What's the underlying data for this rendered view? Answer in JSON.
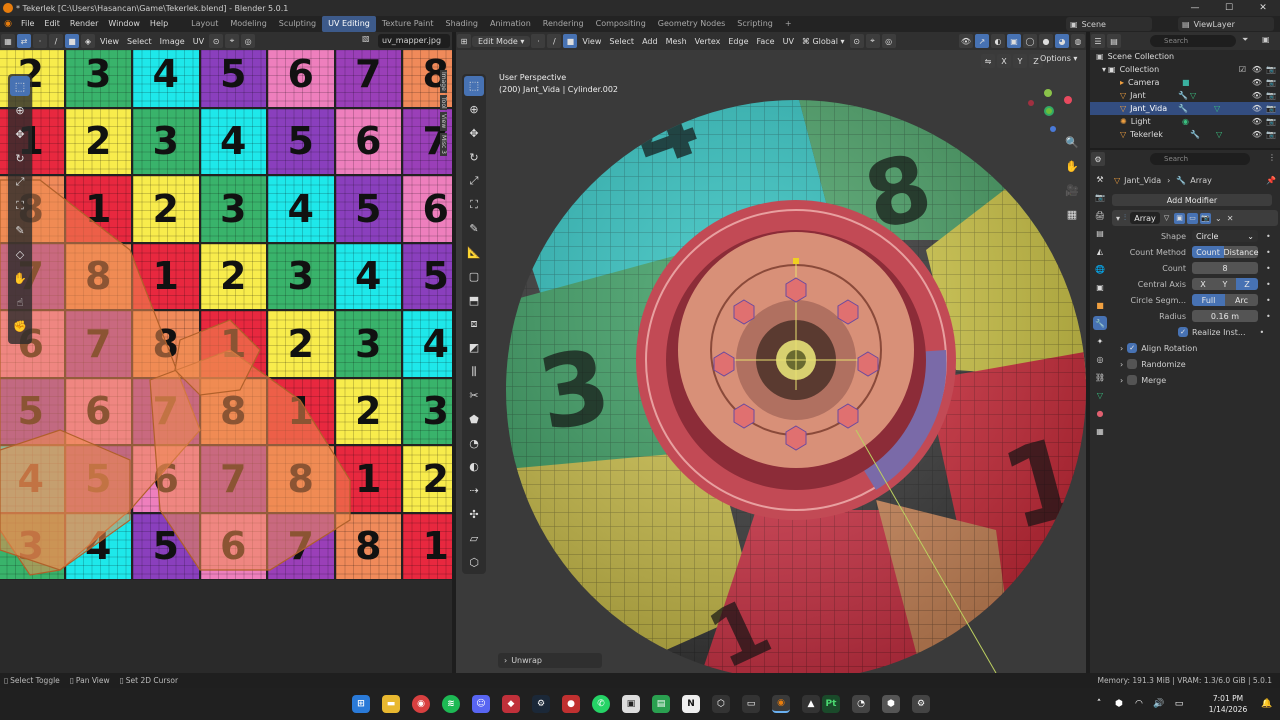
{
  "window": {
    "title": "* Tekerlek [C:\\Users\\Hasancan\\Game\\Tekerlek.blend] - Blender 5.0.1"
  },
  "menu": [
    "File",
    "Edit",
    "Render",
    "Window",
    "Help"
  ],
  "workspaces": [
    "Layout",
    "Modeling",
    "Sculpting",
    "UV Editing",
    "Texture Paint",
    "Shading",
    "Animation",
    "Rendering",
    "Compositing",
    "Geometry Nodes",
    "Scripting"
  ],
  "active_workspace": "UV Editing",
  "scene": {
    "label": "Scene",
    "view_layer": "ViewLayer"
  },
  "uv_editor": {
    "menus": [
      "View",
      "Select",
      "Image",
      "UV"
    ],
    "image_name": "uv_mapper.jpg",
    "side_tabs": [
      "Image",
      "Tool",
      "View",
      "Misc 3"
    ],
    "grid": [
      [
        {
          "n": "2",
          "c": "#f8ec4c"
        },
        {
          "n": "3",
          "c": "#39b36b"
        },
        {
          "n": "4",
          "c": "#1ee8ea"
        },
        {
          "n": "5",
          "c": "#8a3fbd"
        },
        {
          "n": "6",
          "c": "#ee7fbd"
        },
        {
          "n": "7",
          "c": "#9a3fb8"
        },
        {
          "n": "8",
          "c": "#f08a5a"
        }
      ],
      [
        {
          "n": "1",
          "c": "#e8283f"
        },
        {
          "n": "2",
          "c": "#f8ec4c"
        },
        {
          "n": "3",
          "c": "#39b36b"
        },
        {
          "n": "4",
          "c": "#1ee8ea"
        },
        {
          "n": "5",
          "c": "#8a3fbd"
        },
        {
          "n": "6",
          "c": "#ee7fbd"
        },
        {
          "n": "7",
          "c": "#9a3fb8"
        }
      ],
      [
        {
          "n": "8",
          "c": "#f08a5a"
        },
        {
          "n": "1",
          "c": "#e8283f"
        },
        {
          "n": "2",
          "c": "#f8ec4c"
        },
        {
          "n": "3",
          "c": "#39b36b"
        },
        {
          "n": "4",
          "c": "#1ee8ea"
        },
        {
          "n": "5",
          "c": "#8a3fbd"
        },
        {
          "n": "6",
          "c": "#ee7fbd"
        }
      ],
      [
        {
          "n": "7",
          "c": "#9a3fb8"
        },
        {
          "n": "8",
          "c": "#f08a5a"
        },
        {
          "n": "1",
          "c": "#e8283f"
        },
        {
          "n": "2",
          "c": "#f8ec4c"
        },
        {
          "n": "3",
          "c": "#39b36b"
        },
        {
          "n": "4",
          "c": "#1ee8ea"
        },
        {
          "n": "5",
          "c": "#8a3fbd"
        }
      ],
      [
        {
          "n": "6",
          "c": "#ee7fbd"
        },
        {
          "n": "7",
          "c": "#9a3fb8"
        },
        {
          "n": "8",
          "c": "#f08a5a"
        },
        {
          "n": "1",
          "c": "#e8283f"
        },
        {
          "n": "2",
          "c": "#f8ec4c"
        },
        {
          "n": "3",
          "c": "#39b36b"
        },
        {
          "n": "4",
          "c": "#1ee8ea"
        }
      ],
      [
        {
          "n": "5",
          "c": "#8a3fbd"
        },
        {
          "n": "6",
          "c": "#ee7fbd"
        },
        {
          "n": "7",
          "c": "#9a3fb8"
        },
        {
          "n": "8",
          "c": "#f08a5a"
        },
        {
          "n": "1",
          "c": "#e8283f"
        },
        {
          "n": "2",
          "c": "#f8ec4c"
        },
        {
          "n": "3",
          "c": "#39b36b"
        }
      ],
      [
        {
          "n": "4",
          "c": "#1ee8ea"
        },
        {
          "n": "5",
          "c": "#8a3fbd"
        },
        {
          "n": "6",
          "c": "#ee7fbd"
        },
        {
          "n": "7",
          "c": "#9a3fb8"
        },
        {
          "n": "8",
          "c": "#f08a5a"
        },
        {
          "n": "1",
          "c": "#e8283f"
        },
        {
          "n": "2",
          "c": "#f8ec4c"
        }
      ],
      [
        {
          "n": "3",
          "c": "#39b36b"
        },
        {
          "n": "4",
          "c": "#1ee8ea"
        },
        {
          "n": "5",
          "c": "#8a3fbd"
        },
        {
          "n": "6",
          "c": "#ee7fbd"
        },
        {
          "n": "7",
          "c": "#9a3fb8"
        },
        {
          "n": "8",
          "c": "#f08a5a"
        },
        {
          "n": "1",
          "c": "#e8283f"
        }
      ]
    ]
  },
  "viewport": {
    "mode": "Edit Mode",
    "menus": [
      "View",
      "Select",
      "Add",
      "Mesh",
      "Vertex",
      "Edge",
      "Face",
      "UV"
    ],
    "orientation": "Global",
    "perspective_label": "User Perspective",
    "object_label": "(200) Jant_Vida | Cylinder.002",
    "axis_toggles": [
      "X",
      "Y",
      "Z"
    ],
    "options_label": "Options",
    "last_op": "Unwrap"
  },
  "outliner": {
    "search_placeholder": "Search",
    "items": [
      {
        "label": "Scene Collection",
        "selected": false
      },
      {
        "label": "Collection",
        "selected": false
      },
      {
        "label": "Camera",
        "selected": false
      },
      {
        "label": "Jant",
        "selected": false
      },
      {
        "label": "Jant_Vida",
        "selected": true
      },
      {
        "label": "Light",
        "selected": false
      },
      {
        "label": "Tekerlek",
        "selected": false
      }
    ]
  },
  "properties": {
    "search_placeholder": "Search",
    "object_name": "Jant_Vida",
    "modifier_breadcrumb": "Array",
    "add_modifier": "Add Modifier",
    "modifier_name": "Array",
    "fields": {
      "shape_label": "Shape",
      "shape_value": "Circle",
      "count_method_label": "Count Method",
      "count_method_a": "Count",
      "count_method_b": "Distance",
      "count_label": "Count",
      "count_value": "8",
      "central_axis_label": "Central Axis",
      "axis_x": "X",
      "axis_y": "Y",
      "axis_z": "Z",
      "circle_seg_label": "Circle Segm...",
      "seg_full": "Full",
      "seg_arc": "Arc",
      "radius_label": "Radius",
      "radius_value": "0.16 m",
      "realize_label": "Realize Inst..."
    },
    "panels": [
      "Align Rotation",
      "Randomize",
      "Merge"
    ]
  },
  "statusbar": {
    "left": [
      "Select Toggle",
      "Pan View",
      "Set 2D Cursor"
    ],
    "right": "Memory: 191.3 MiB | VRAM: 1.3/6.0 GiB | 5.0.1"
  },
  "taskbar": {
    "time": "7:01 PM",
    "date": "1/14/2026"
  },
  "colors": {
    "accent": "#4772b3",
    "selected_row": "#334d80",
    "panel_bg": "#2b2b2b"
  }
}
